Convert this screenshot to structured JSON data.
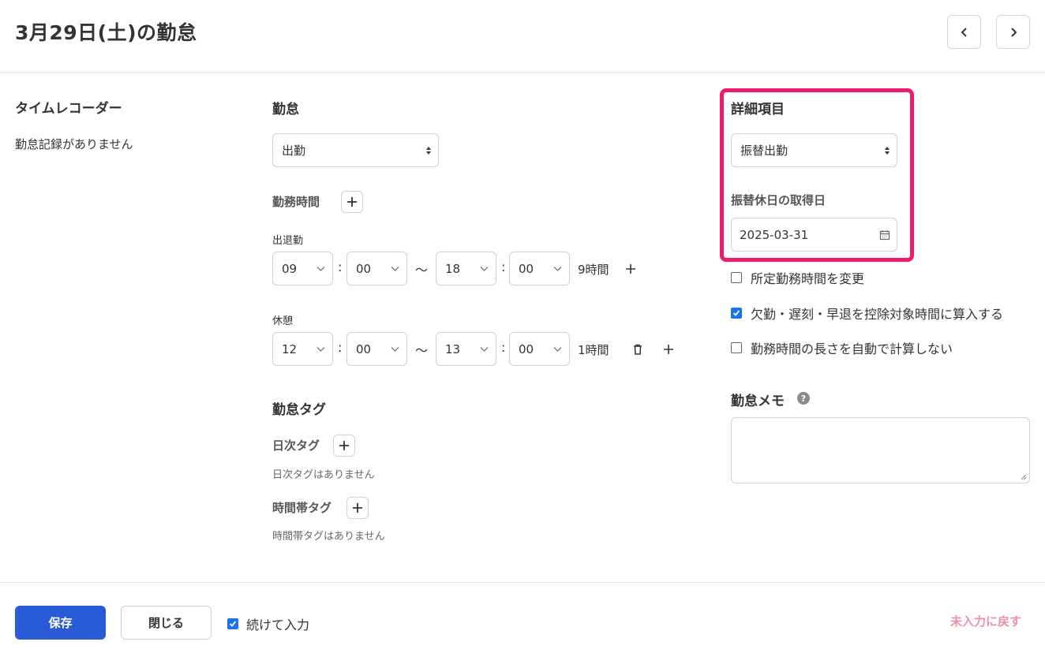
{
  "header": {
    "title": "3月29日(土)の勤怠"
  },
  "timerecorder": {
    "title": "タイムレコーダー",
    "empty_text": "勤怠記録がありません"
  },
  "attendance": {
    "title": "勤怠",
    "type_selected": "出勤",
    "work_hours_label": "勤務時間",
    "clock_label": "出退勤",
    "clock": {
      "start_hour": "09",
      "start_min": "00",
      "end_hour": "18",
      "end_min": "00",
      "duration": "9時間"
    },
    "break_label": "休憩",
    "break": {
      "start_hour": "12",
      "start_min": "00",
      "end_hour": "13",
      "end_min": "00",
      "duration": "1時間"
    },
    "colon": ":",
    "tilde": "〜"
  },
  "tags": {
    "title": "勤怠タグ",
    "daily_label": "日次タグ",
    "daily_empty": "日次タグはありません",
    "timeband_label": "時間帯タグ",
    "timeband_empty": "時間帯タグはありません"
  },
  "details": {
    "title": "詳細項目",
    "selected": "振替出勤",
    "transfer_label": "振替休日の取得日",
    "transfer_date": "2025-03-31",
    "highlight_color": "#ee1a6a"
  },
  "options": {
    "change_scheduled": {
      "label": "所定勤務時間を変更",
      "checked": false
    },
    "deduct": {
      "label": "欠勤・遅刻・早退を控除対象時間に算入する",
      "checked": true
    },
    "no_auto_calc": {
      "label": "勤務時間の長さを自動で計算しない",
      "checked": false
    }
  },
  "memo": {
    "title": "勤怠メモ",
    "help_icon": "?",
    "value": ""
  },
  "footer": {
    "save_label": "保存",
    "close_label": "閉じる",
    "continue_label": "続けて入力",
    "continue_checked": true,
    "revert_label": "未入力に戻す"
  },
  "colors": {
    "primary": "#2a5bd7",
    "checkbox": "#1a73e8",
    "revert": "#f08ea3"
  }
}
